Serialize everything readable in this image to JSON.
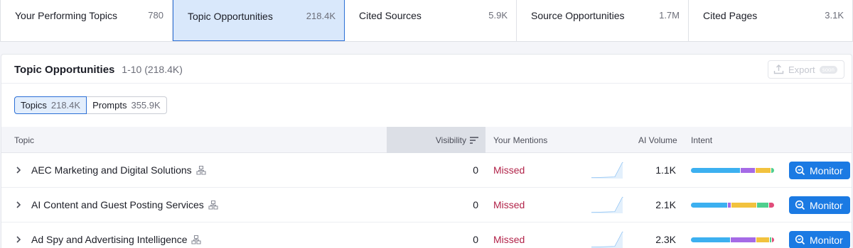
{
  "tabs": [
    {
      "label": "Your Performing Topics",
      "value": "780"
    },
    {
      "label": "Topic Opportunities",
      "value": "218.4K"
    },
    {
      "label": "Cited Sources",
      "value": "5.9K"
    },
    {
      "label": "Source Opportunities",
      "value": "1.7M"
    },
    {
      "label": "Cited Pages",
      "value": "3.1K"
    }
  ],
  "panel": {
    "title": "Topic Opportunities",
    "range": "1-10 (218.4K)",
    "export_label": "Export",
    "export_badge": "soon"
  },
  "segments": [
    {
      "label": "Topics",
      "count": "218.4K"
    },
    {
      "label": "Prompts",
      "count": "355.9K"
    }
  ],
  "columns": {
    "topic": "Topic",
    "visibility": "Visibility",
    "mentions": "Your Mentions",
    "ai_volume": "AI Volume",
    "intent": "Intent"
  },
  "rows": [
    {
      "topic": "AEC Marketing and Digital Solutions",
      "visibility": "0",
      "mentions": "Missed",
      "ai_volume": "1.1K",
      "monitor_label": "Monitor",
      "intent": [
        0.59,
        0.18,
        0.19,
        0.04
      ]
    },
    {
      "topic": "AI Content and Guest Posting Services",
      "visibility": "0",
      "mentions": "Missed",
      "ai_volume": "2.1K",
      "monitor_label": "Monitor",
      "intent": [
        0.44,
        0.04,
        0.31,
        0.14,
        0.07
      ]
    },
    {
      "topic": "Ad Spy and Advertising Intelligence",
      "visibility": "0",
      "mentions": "Missed",
      "ai_volume": "2.3K",
      "monitor_label": "Monitor",
      "intent": [
        0.47,
        0.31,
        0.16,
        0.03,
        0.03
      ]
    }
  ],
  "intent_colors": [
    "#3cb0f0",
    "#a56ae6",
    "#f2c23e",
    "#4fcf8e",
    "#e14d7a"
  ],
  "colors": {
    "accent": "#1b7ae3",
    "missed": "#b2244a",
    "active_tab": "#d9e8fb"
  }
}
